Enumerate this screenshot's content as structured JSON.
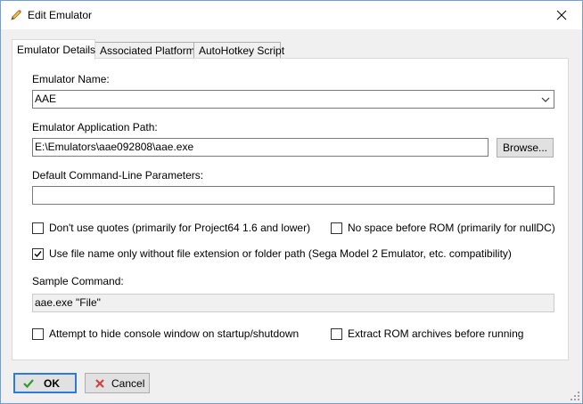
{
  "window": {
    "title": "Edit Emulator"
  },
  "tabs": [
    {
      "label": "Emulator Details",
      "active": true
    },
    {
      "label": "Associated Platforms",
      "active": false
    },
    {
      "label": "AutoHotkey Script",
      "active": false
    }
  ],
  "form": {
    "emulator_name_label": "Emulator Name:",
    "emulator_name_value": "AAE",
    "app_path_label": "Emulator Application Path:",
    "app_path_value": "E:\\Emulators\\aae092808\\aae.exe",
    "browse_label": "Browse...",
    "params_label": "Default Command-Line Parameters:",
    "params_value": "",
    "options": {
      "no_quotes": {
        "label": "Don't use quotes (primarily for Project64 1.6 and lower)",
        "checked": false
      },
      "no_space": {
        "label": "No space before ROM (primarily for nullDC)",
        "checked": false
      },
      "file_name_only": {
        "label": "Use file name only without file extension or folder path (Sega Model 2 Emulator, etc. compatibility)",
        "checked": true
      },
      "hide_console": {
        "label": "Attempt to hide console window on startup/shutdown",
        "checked": false
      },
      "extract_rom": {
        "label": "Extract ROM archives before running",
        "checked": false
      }
    },
    "sample_label": "Sample Command:",
    "sample_value": "aae.exe \"File\""
  },
  "footer": {
    "ok_label": "OK",
    "cancel_label": "Cancel"
  },
  "colors": {
    "ok_border": "#2f7ad9",
    "ok_check": "#2e9b2e",
    "cancel_x": "#d04040"
  }
}
